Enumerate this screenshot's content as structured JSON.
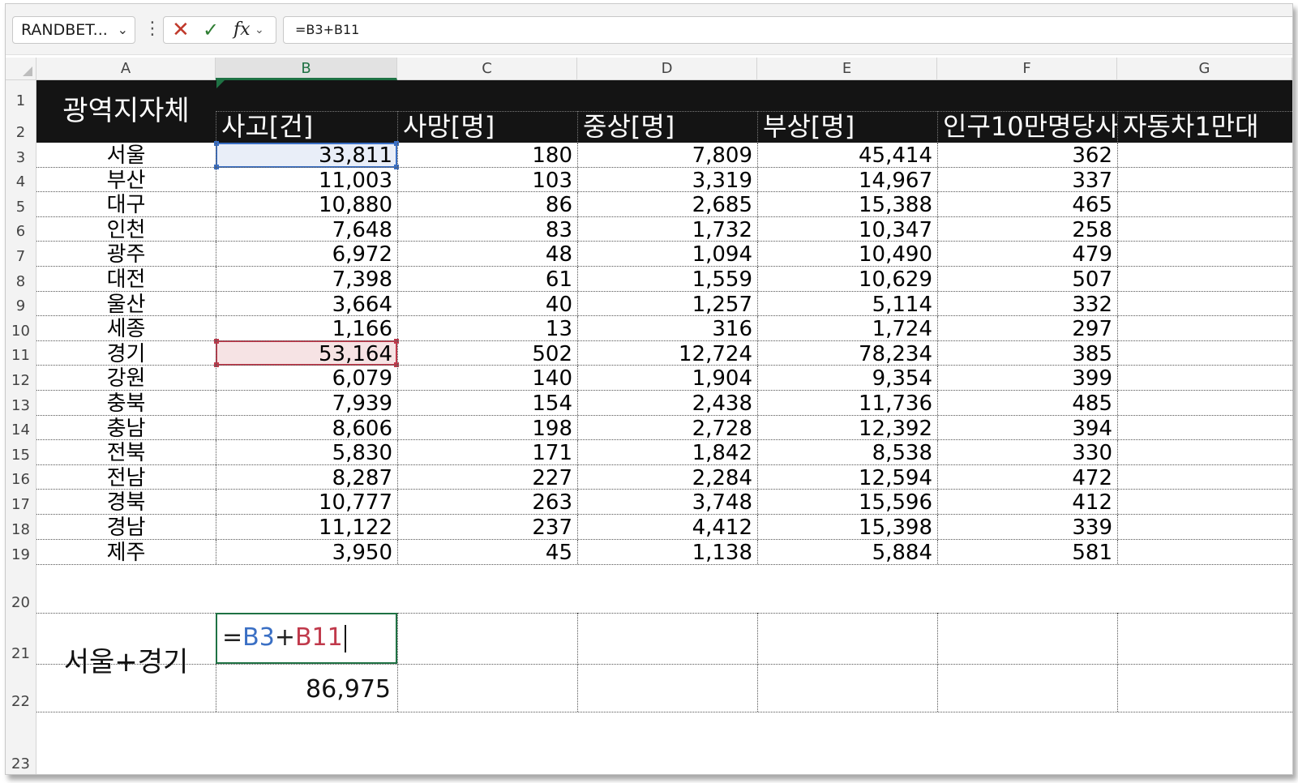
{
  "name_box": {
    "value": "RANDBET...",
    "chevron": "chevron-down-icon"
  },
  "formula_bar": {
    "more_icon": "⋮",
    "cancel_icon": "✕",
    "enter_icon": "✓",
    "fx_label": "fx",
    "formula": "=B3+B11"
  },
  "columns": [
    "A",
    "B",
    "C",
    "D",
    "E",
    "F",
    "G"
  ],
  "selected_column": "B",
  "rows": [
    "1",
    "2",
    "3",
    "4",
    "5",
    "6",
    "7",
    "8",
    "9",
    "10",
    "11",
    "12",
    "13",
    "14",
    "15",
    "16",
    "17",
    "18",
    "19",
    "20",
    "21",
    "22",
    "23"
  ],
  "header": {
    "title": "광역지자체",
    "cols": [
      "사고[건]",
      "사망[명]",
      "중상[명]",
      "부상[명]",
      "인구10만명당사",
      "자동차1만대"
    ]
  },
  "table": [
    {
      "region": "서울",
      "accidents": "33,811",
      "deaths": "180",
      "serious": "7,809",
      "injuries": "45,414",
      "per100k": "362"
    },
    {
      "region": "부산",
      "accidents": "11,003",
      "deaths": "103",
      "serious": "3,319",
      "injuries": "14,967",
      "per100k": "337"
    },
    {
      "region": "대구",
      "accidents": "10,880",
      "deaths": "86",
      "serious": "2,685",
      "injuries": "15,388",
      "per100k": "465"
    },
    {
      "region": "인천",
      "accidents": "7,648",
      "deaths": "83",
      "serious": "1,732",
      "injuries": "10,347",
      "per100k": "258"
    },
    {
      "region": "광주",
      "accidents": "6,972",
      "deaths": "48",
      "serious": "1,094",
      "injuries": "10,490",
      "per100k": "479"
    },
    {
      "region": "대전",
      "accidents": "7,398",
      "deaths": "61",
      "serious": "1,559",
      "injuries": "10,629",
      "per100k": "507"
    },
    {
      "region": "울산",
      "accidents": "3,664",
      "deaths": "40",
      "serious": "1,257",
      "injuries": "5,114",
      "per100k": "332"
    },
    {
      "region": "세종",
      "accidents": "1,166",
      "deaths": "13",
      "serious": "316",
      "injuries": "1,724",
      "per100k": "297"
    },
    {
      "region": "경기",
      "accidents": "53,164",
      "deaths": "502",
      "serious": "12,724",
      "injuries": "78,234",
      "per100k": "385"
    },
    {
      "region": "강원",
      "accidents": "6,079",
      "deaths": "140",
      "serious": "1,904",
      "injuries": "9,354",
      "per100k": "399"
    },
    {
      "region": "충북",
      "accidents": "7,939",
      "deaths": "154",
      "serious": "2,438",
      "injuries": "11,736",
      "per100k": "485"
    },
    {
      "region": "충남",
      "accidents": "8,606",
      "deaths": "198",
      "serious": "2,728",
      "injuries": "12,392",
      "per100k": "394"
    },
    {
      "region": "전북",
      "accidents": "5,830",
      "deaths": "171",
      "serious": "1,842",
      "injuries": "8,538",
      "per100k": "330"
    },
    {
      "region": "전남",
      "accidents": "8,287",
      "deaths": "227",
      "serious": "2,284",
      "injuries": "12,594",
      "per100k": "472"
    },
    {
      "region": "경북",
      "accidents": "10,777",
      "deaths": "263",
      "serious": "3,748",
      "injuries": "15,596",
      "per100k": "412"
    },
    {
      "region": "경남",
      "accidents": "11,122",
      "deaths": "237",
      "serious": "4,412",
      "injuries": "15,398",
      "per100k": "339"
    },
    {
      "region": "제주",
      "accidents": "3,950",
      "deaths": "45",
      "serious": "1,138",
      "injuries": "5,884",
      "per100k": "581"
    }
  ],
  "summary": {
    "label": "서울+경기",
    "edit": {
      "eq": "=",
      "ref1": "B3",
      "plus": "+",
      "ref2": "B11"
    },
    "result": "86,975"
  },
  "colors": {
    "ref1": "#3a6fc4",
    "ref2": "#c0394b",
    "active": "#1f7244",
    "header_band": "#141414"
  }
}
